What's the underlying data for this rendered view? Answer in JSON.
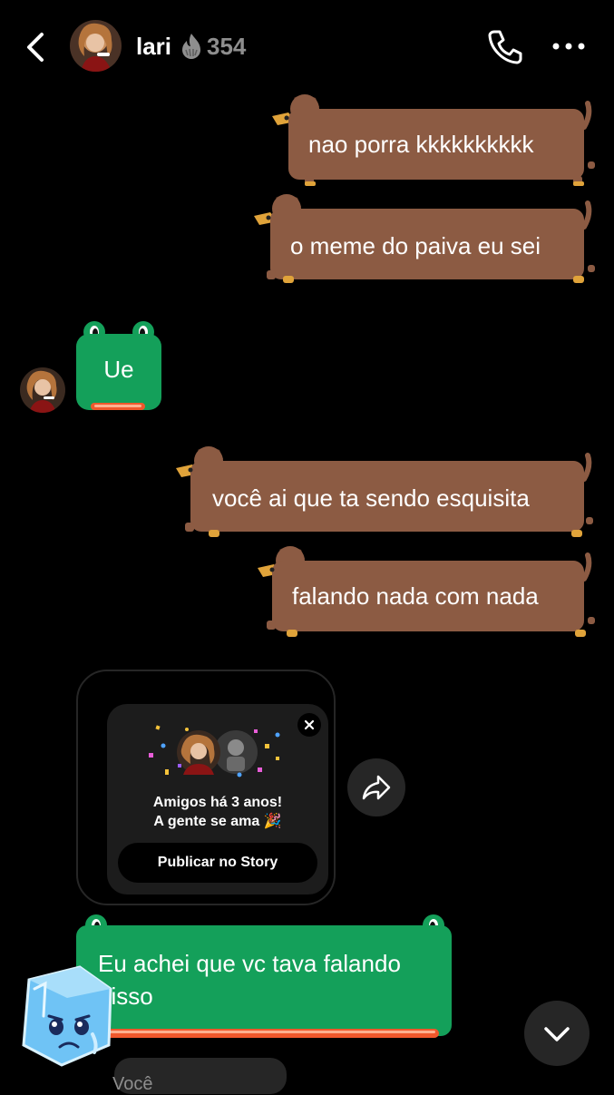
{
  "header": {
    "username": "lari",
    "streak_count": "354",
    "back_icon": "chevron-left-icon",
    "call_icon": "phone-icon",
    "more_icon": "more-horizontal-icon",
    "streak_icon": "flame-icon"
  },
  "messages": [
    {
      "sender": "me",
      "text": "nao porra kkkkkkkkkk"
    },
    {
      "sender": "me",
      "text": "o meme do paiva eu sei"
    },
    {
      "sender": "lari",
      "text": "Ue"
    },
    {
      "sender": "me",
      "text": "você ai que ta sendo esquisita"
    },
    {
      "sender": "me",
      "text": "falando nada com nada"
    }
  ],
  "friendship_card": {
    "title_line1": "Amigos há 3 anos!",
    "title_line2": "A gente se ama 🎉",
    "button_label": "Publicar no Story"
  },
  "last_message": {
    "sender": "lari",
    "text": "Eu achei que vc tava falando disso"
  },
  "next_preview": {
    "text": "Você"
  },
  "colors": {
    "background": "#000000",
    "outgoing_bubble": "#8c5b43",
    "incoming_bubble": "#14a05a",
    "accent_orange": "#f0582c",
    "muted_text": "#8e8e8e",
    "dark_surface": "#262626"
  }
}
